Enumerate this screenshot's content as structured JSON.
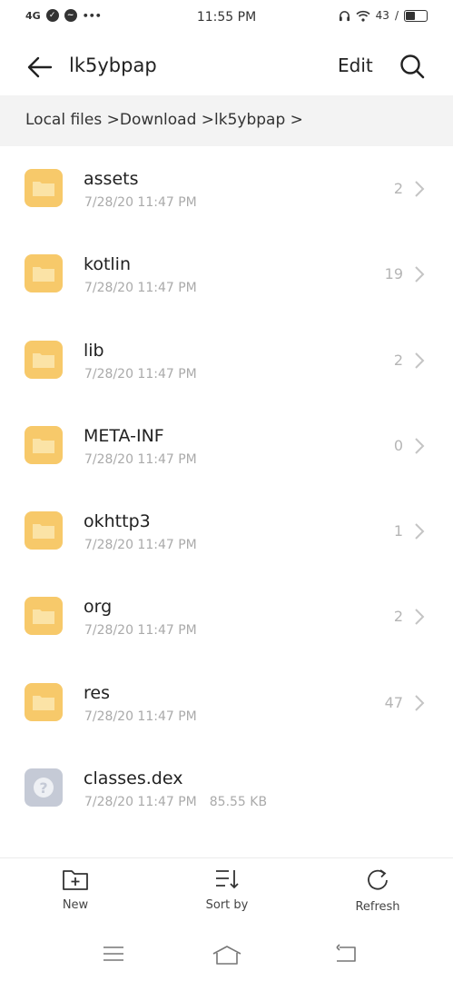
{
  "status_bar": {
    "network": "4G",
    "time": "11:55 PM",
    "battery": "43"
  },
  "header": {
    "title": "lk5ybpap",
    "edit_label": "Edit"
  },
  "breadcrumb": "Local files >Download >lk5ybpap >",
  "items": [
    {
      "name": "assets",
      "date": "7/28/20 11:47 PM",
      "count": "2",
      "type": "folder"
    },
    {
      "name": "kotlin",
      "date": "7/28/20 11:47 PM",
      "count": "19",
      "type": "folder"
    },
    {
      "name": "lib",
      "date": "7/28/20 11:47 PM",
      "count": "2",
      "type": "folder"
    },
    {
      "name": "META-INF",
      "date": "7/28/20 11:47 PM",
      "count": "0",
      "type": "folder"
    },
    {
      "name": "okhttp3",
      "date": "7/28/20 11:47 PM",
      "count": "1",
      "type": "folder"
    },
    {
      "name": "org",
      "date": "7/28/20 11:47 PM",
      "count": "2",
      "type": "folder"
    },
    {
      "name": "res",
      "date": "7/28/20 11:47 PM",
      "count": "47",
      "type": "folder"
    },
    {
      "name": "classes.dex",
      "date": "7/28/20 11:47 PM",
      "size": "85.55 KB",
      "type": "file"
    }
  ],
  "bottom_bar": {
    "new_label": "New",
    "sort_label": "Sort by",
    "refresh_label": "Refresh"
  },
  "colors": {
    "folder": "#f7c96a",
    "folder_inner": "#fbe3a6",
    "unknown_file": "#c5cad6"
  }
}
